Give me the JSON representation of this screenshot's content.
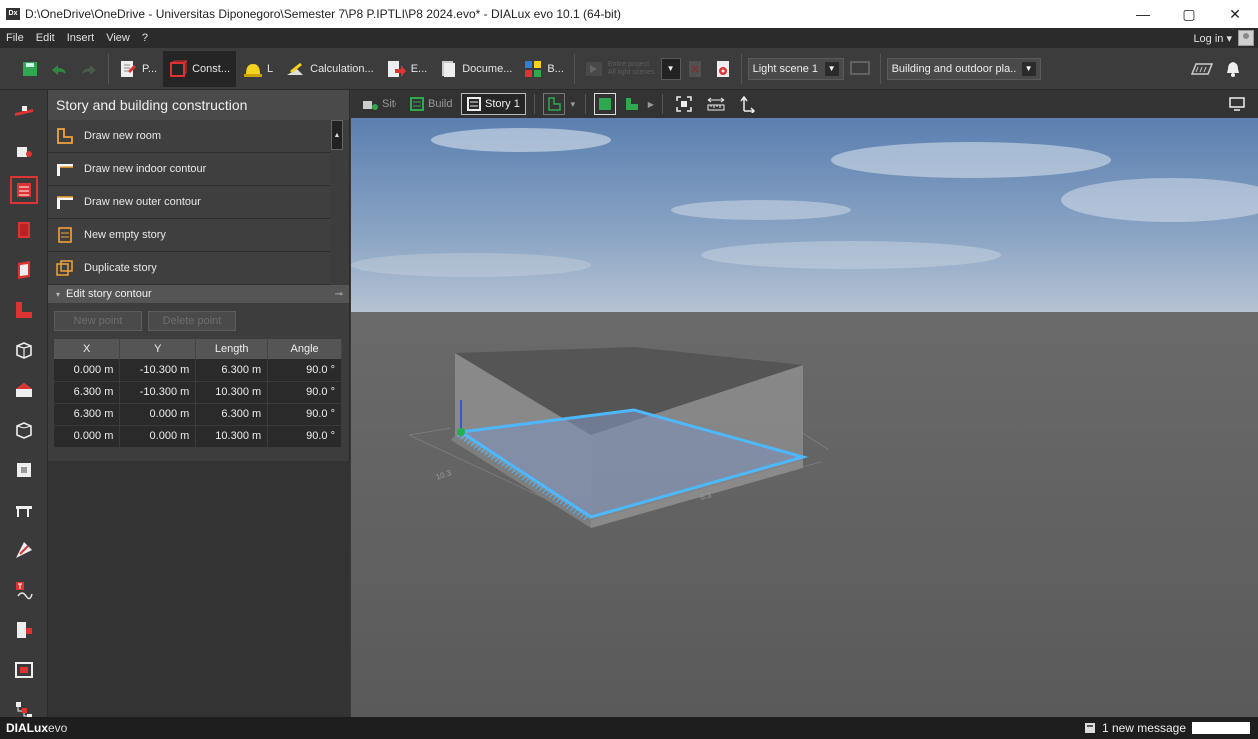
{
  "window": {
    "app_icon": "Dx",
    "title": "D:\\OneDrive\\OneDrive - Universitas Diponegoro\\Semester 7\\P8 P.IPTLI\\P8 2024.evo* - DIALux evo 10.1  (64-bit)",
    "minimize": "—",
    "maximize": "▢",
    "close": "✕"
  },
  "menu": {
    "items": [
      "File",
      "Edit",
      "Insert",
      "View",
      "?"
    ],
    "login": "Log in ▾"
  },
  "toolbar": {
    "save_icon": "save-icon",
    "tabs": [
      {
        "label": "P...",
        "icon": "project-icon"
      },
      {
        "label": "Const...",
        "icon": "construction-icon",
        "active": true
      },
      {
        "label": "L",
        "icon": "light-icon"
      },
      {
        "label": "Calculation...",
        "icon": "calculation-icon"
      },
      {
        "label": "E...",
        "icon": "export-icon"
      },
      {
        "label": "Docume...",
        "icon": "document-icon"
      },
      {
        "label": "B...",
        "icon": "bim-icon"
      }
    ],
    "entire_project": "Entire project",
    "all_light_scenes": "All light scenes",
    "light_scene": "Light scene 1",
    "building_plan": "Building and outdoor pla..."
  },
  "panel": {
    "title": "Story and building construction",
    "actions": [
      "Draw new room",
      "Draw new indoor contour",
      "Draw new outer contour",
      "New empty story",
      "Duplicate story"
    ],
    "edit_section": "Edit story contour",
    "new_point": "New point",
    "delete_point": "Delete point",
    "table": {
      "headers": [
        "X",
        "Y",
        "Length",
        "Angle"
      ],
      "rows": [
        [
          "0.000  m",
          "-10.300  m",
          "6.300  m",
          "90.0  °"
        ],
        [
          "6.300  m",
          "-10.300  m",
          "10.300  m",
          "90.0  °"
        ],
        [
          "6.300  m",
          "0.000  m",
          "6.300  m",
          "90.0  °"
        ],
        [
          "0.000  m",
          "0.000  m",
          "10.300  m",
          "90.0  °"
        ]
      ]
    }
  },
  "viewport": {
    "tabs": [
      "Site",
      "Build",
      "Story 1"
    ],
    "dim_label_a": "10.3",
    "dim_label_b": "6.3"
  },
  "status": {
    "brand_bold": "DIALux",
    "brand_rest": "evo",
    "message": "1 new message"
  },
  "colors": {
    "accent_red": "#d8312b",
    "accent_green": "#22b14c",
    "contour_blue": "#4db8ff",
    "sky_top": "#5b7fb0"
  }
}
